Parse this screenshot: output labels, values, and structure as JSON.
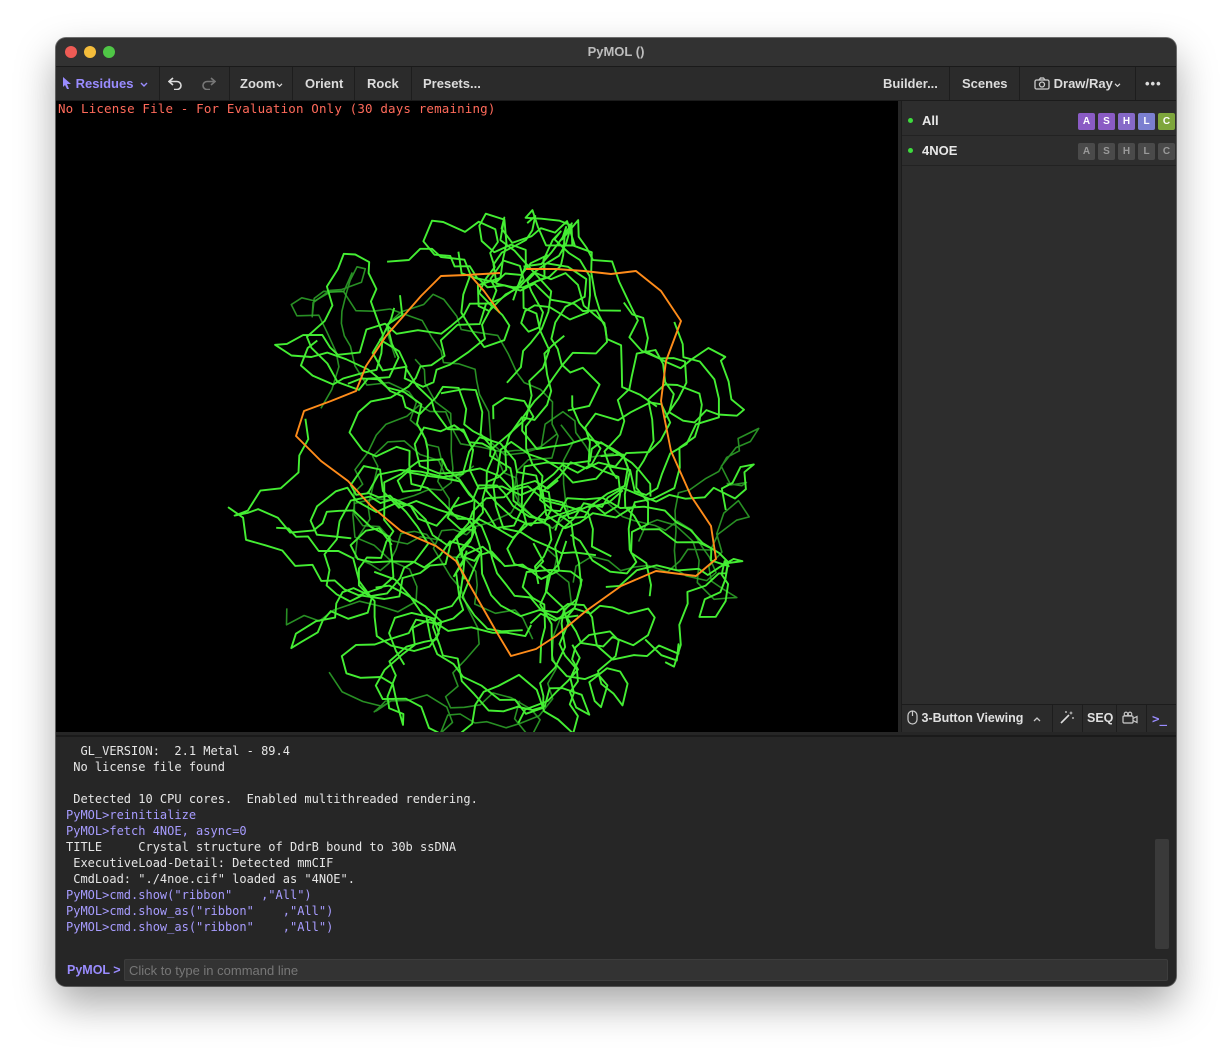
{
  "window": {
    "title": "PyMOL ()"
  },
  "toolbar": {
    "mode_label": "Residues",
    "zoom_label": "Zoom",
    "orient_label": "Orient",
    "rock_label": "Rock",
    "presets_label": "Presets...",
    "builder_label": "Builder...",
    "scenes_label": "Scenes",
    "drawray_label": "Draw/Ray",
    "more_label": "•••"
  },
  "viewport": {
    "license_text": "No License File - For Evaluation Only (30 days remaining)",
    "colors": {
      "chain_a": "#44ee33",
      "chain_b": "#2fa82a",
      "dna": "#ff8c1a"
    }
  },
  "objects": [
    {
      "name": "All",
      "buttons": [
        "A",
        "S",
        "H",
        "L",
        "C"
      ]
    },
    {
      "name": "4NOE",
      "buttons": [
        "A",
        "S",
        "H",
        "L",
        "C"
      ]
    }
  ],
  "panel_bottom": {
    "viewing_mode": "3-Button Viewing",
    "seq_label": "SEQ",
    "console_label": ">_"
  },
  "console": {
    "lines": [
      {
        "text": "  GL_VERSION:  2.1 Metal - 89.4",
        "type": "out"
      },
      {
        "text": " No license file found",
        "type": "out"
      },
      {
        "text": "",
        "type": "out"
      },
      {
        "text": " Detected 10 CPU cores.  Enabled multithreaded rendering.",
        "type": "out"
      },
      {
        "text": "PyMOL>reinitialize",
        "type": "cmd"
      },
      {
        "text": "PyMOL>fetch 4NOE, async=0",
        "type": "cmd"
      },
      {
        "text": "TITLE     Crystal structure of DdrB bound to 30b ssDNA",
        "type": "out"
      },
      {
        "text": " ExecutiveLoad-Detail: Detected mmCIF",
        "type": "out"
      },
      {
        "text": " CmdLoad: \"./4noe.cif\" loaded as \"4NOE\".",
        "type": "out"
      },
      {
        "text": "PyMOL>cmd.show(\"ribbon\"    ,\"All\")",
        "type": "cmd"
      },
      {
        "text": "PyMOL>cmd.show_as(\"ribbon\"    ,\"All\")",
        "type": "cmd"
      },
      {
        "text": "PyMOL>cmd.show_as(\"ribbon\"    ,\"All\")",
        "type": "cmd"
      }
    ],
    "prompt": "PyMOL >",
    "placeholder": "Click to type in command line"
  }
}
